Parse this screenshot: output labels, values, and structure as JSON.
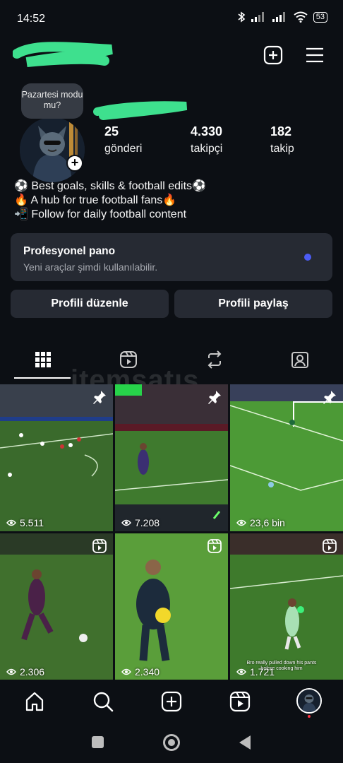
{
  "status_bar": {
    "time": "14:52",
    "battery": "53"
  },
  "profile": {
    "note": "Pazartesi modu mu?",
    "stats": [
      {
        "value": "25",
        "label": "gönderi"
      },
      {
        "value": "4.330",
        "label": "takipçi"
      },
      {
        "value": "182",
        "label": "takip"
      }
    ],
    "bio": [
      "⚽ Best goals, skills & football edits⚽",
      "🔥 A hub for true football fans🔥",
      "📲 Follow for daily football content"
    ]
  },
  "pro_panel": {
    "title": "Profesyonel pano",
    "subtitle": "Yeni araçlar şimdi kullanılabilir."
  },
  "buttons": {
    "edit": "Profili düzenle",
    "share": "Profili paylaş"
  },
  "tabs": [
    "grid-icon",
    "reels-icon",
    "reposts-icon",
    "tagged-icon"
  ],
  "watermark": "itemsatış",
  "posts": [
    {
      "views": "5.511",
      "badge": "pin-icon"
    },
    {
      "views": "7.208",
      "badge": "pin-icon"
    },
    {
      "views": "23,6 bin",
      "badge": "pin-icon"
    },
    {
      "views": "2.306",
      "badge": "reel-icon"
    },
    {
      "views": "2.340",
      "badge": "reel-icon"
    },
    {
      "views": "1.721",
      "badge": "reel-icon",
      "caption": "Bro really pulled down his pants before cooking him"
    }
  ],
  "bottom_nav": [
    "home-icon",
    "search-icon",
    "create-icon",
    "reels-icon",
    "profile-avatar"
  ],
  "colors": {
    "background": "#0c0f14",
    "panel": "#262a33",
    "accent_dot": "#4c5cf5",
    "scribble": "#3ee08e"
  }
}
